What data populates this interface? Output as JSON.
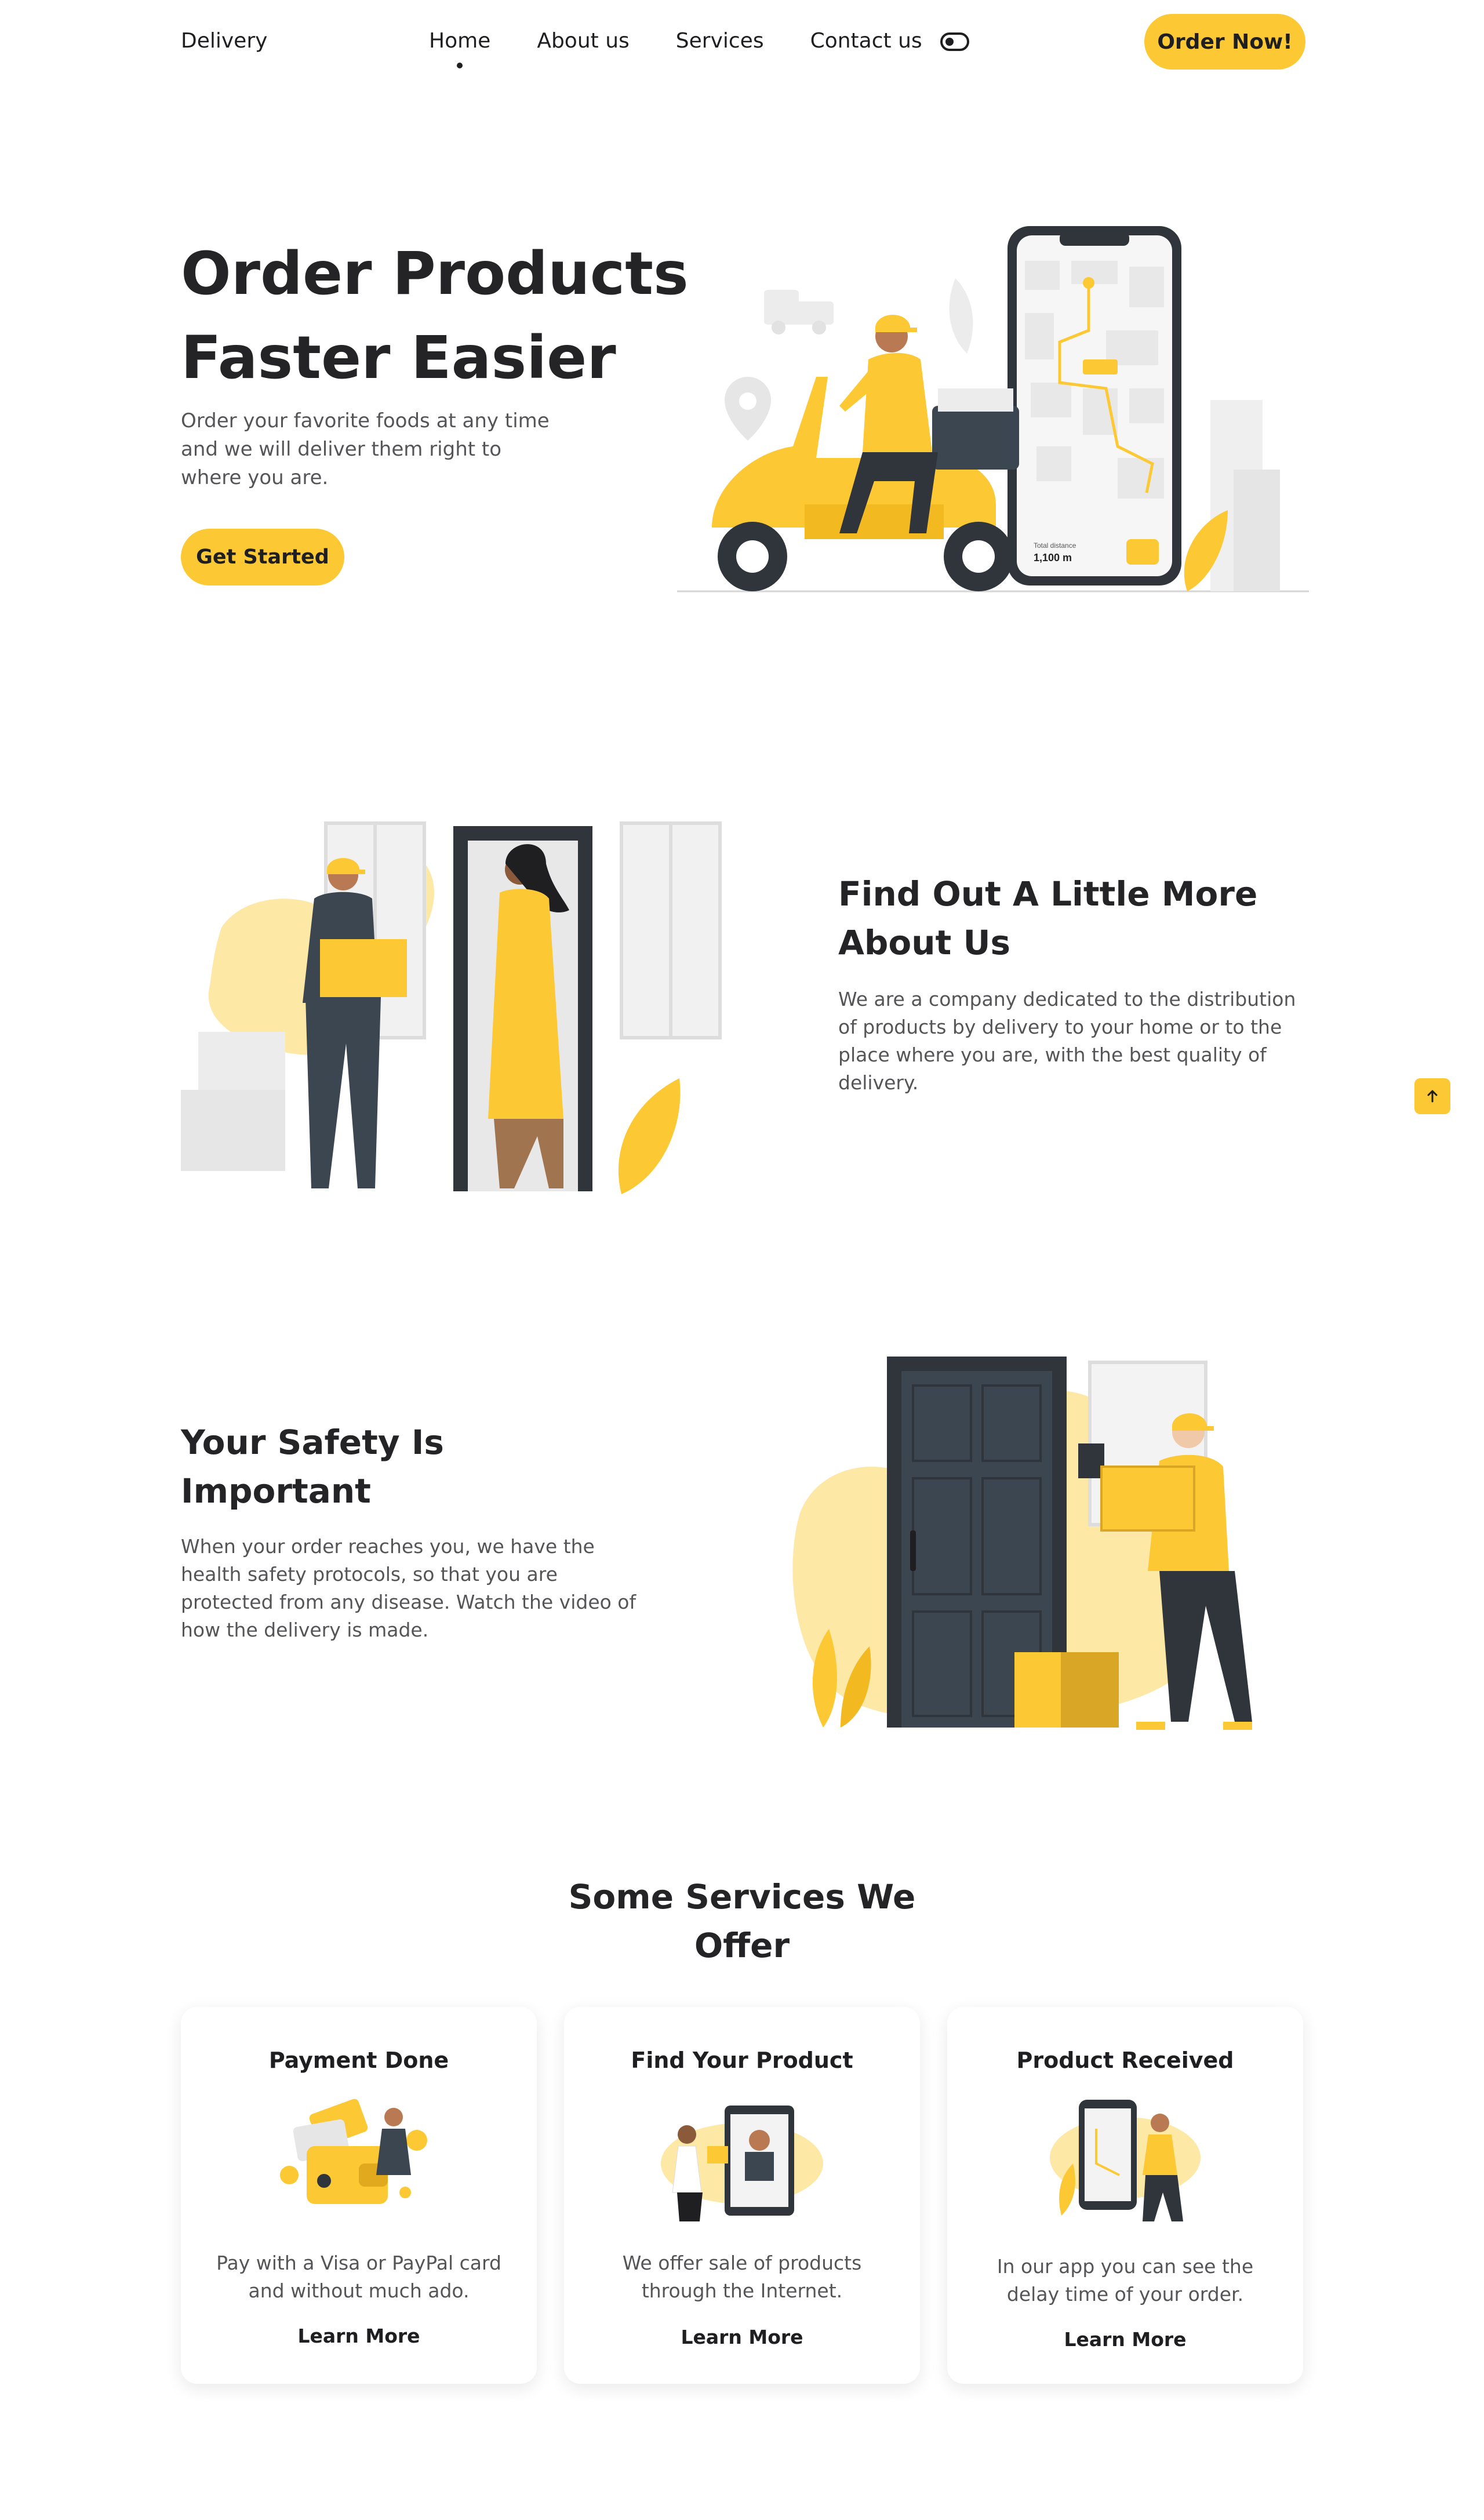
{
  "header": {
    "logo": "Delivery",
    "nav": [
      "Home",
      "About us",
      "Services",
      "Contact us"
    ],
    "active_nav": "Home",
    "order_button": "Order Now!"
  },
  "hero": {
    "title_line1": "Order Products",
    "title_line2": "Faster Easier",
    "description": "Order your favorite foods at any time and we will deliver them right to where you are.",
    "cta": "Get Started",
    "phone_distance_label": "Total distance",
    "phone_distance_value": "1,100 m"
  },
  "about": {
    "title_line1": "Find Out A Little More",
    "title_line2": "About Us",
    "description": "We are a company dedicated to the distribution of products by delivery to your home or to the place where you are, with the best quality of delivery."
  },
  "safety": {
    "title_line1": "Your Safety Is",
    "title_line2": "Important",
    "description": "When your order reaches you, we have the health safety protocols, so that you are protected from any disease. Watch the video of how the delivery is made."
  },
  "services": {
    "title_line1": "Some Services We",
    "title_line2": "Offer",
    "cards": [
      {
        "title": "Payment Done",
        "description": "Pay with a Visa or PayPal card and without much ado.",
        "link": "Learn More"
      },
      {
        "title": "Find Your Product",
        "description": "We offer sale of products through the Internet.",
        "link": "Learn More"
      },
      {
        "title": "Product Received",
        "description": "In our app you can see the delay time of your order.",
        "link": "Learn More"
      }
    ]
  },
  "icons": {
    "theme_toggle": "toggle-icon",
    "scroll_top": "arrow-up-icon"
  },
  "colors": {
    "accent": "#fcc934",
    "dark": "#242426",
    "text": "#555558",
    "slate": "#3b4650"
  }
}
